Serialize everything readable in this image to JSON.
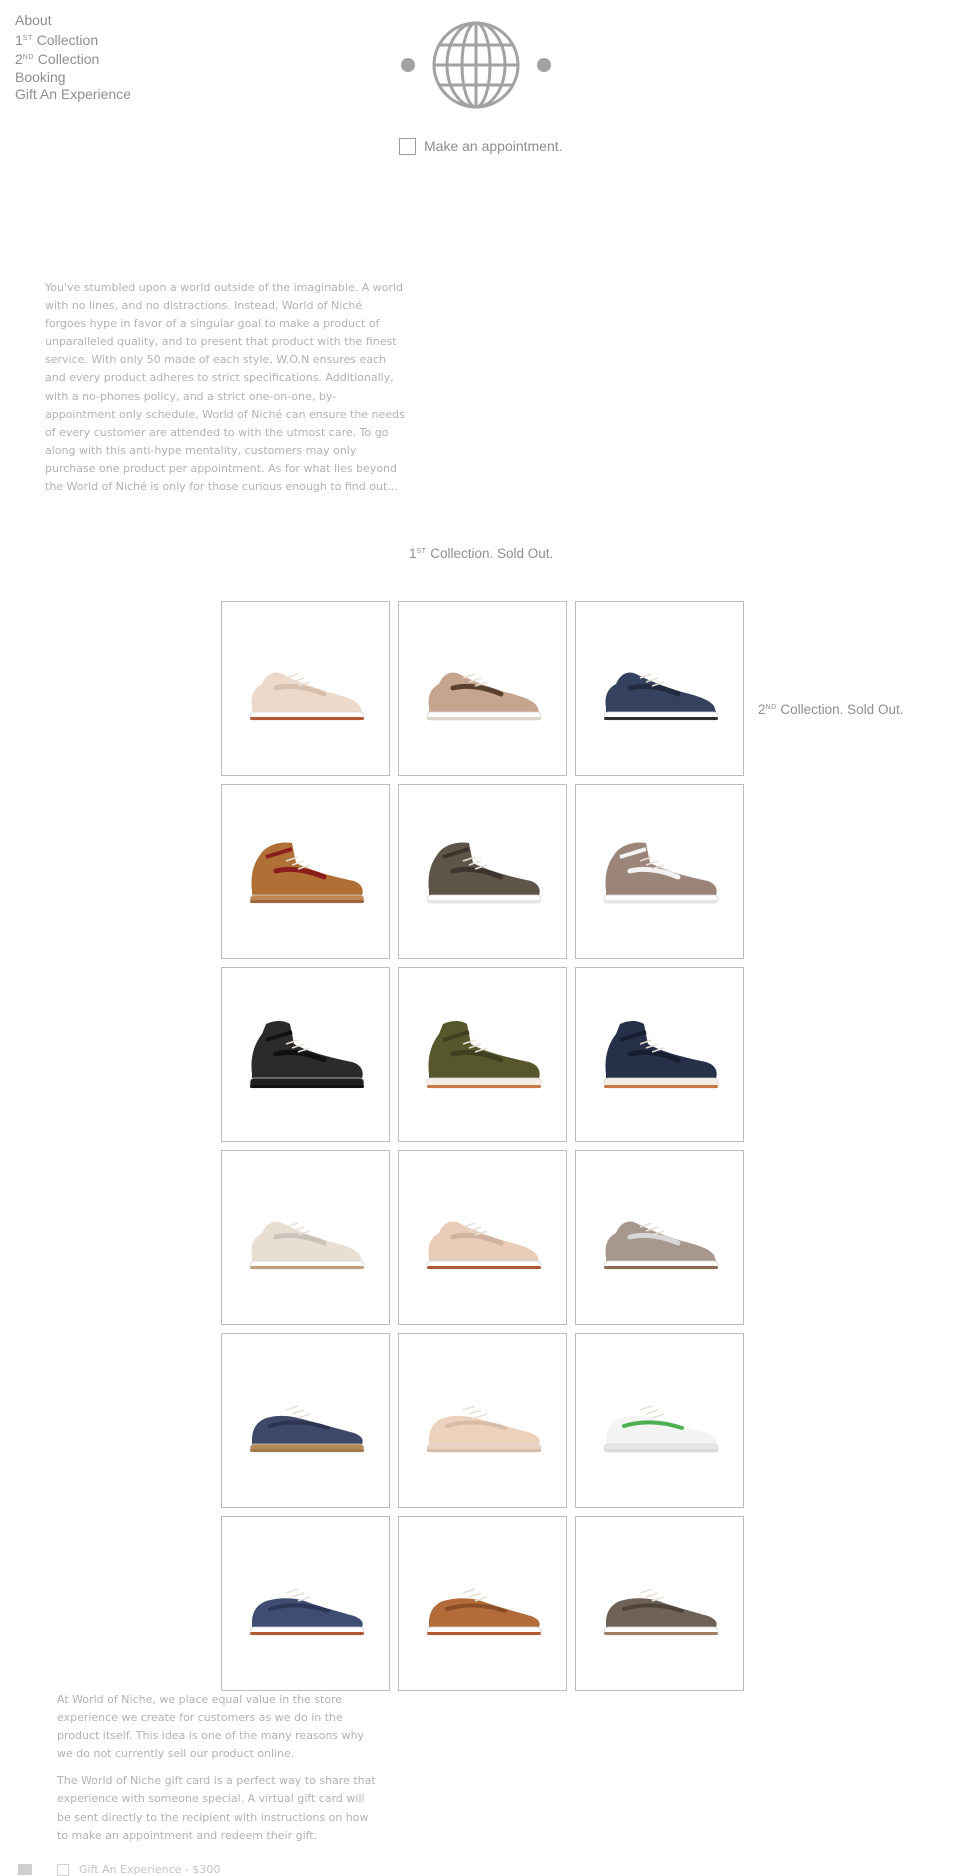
{
  "nav": {
    "about": "About",
    "c1_num": "1",
    "c1_sup": "ST",
    "c1_label": " Collection",
    "c2_num": "2",
    "c2_sup": "ND",
    "c2_label": " Collection",
    "booking": "Booking",
    "gift": "Gift An Experience"
  },
  "logo": {
    "icon": "globe-icon"
  },
  "appointment": {
    "label": "Make an appointment."
  },
  "intro": "You've stumbled upon a world outside of the imaginable. A world with no lines, and no distractions. Instead, World of Niché forgoes hype in favor of a singular goal to make a product of unparalleled quality, and to present that product with the finest service. With only 50 made of each style, W.O.N ensures each and every product adheres to strict specifications. Additionally, with a no-phones policy, and a strict one-on-one, by-appointment only schedule, World of Niché can ensure the needs of every customer are attended to with the utmost care. To go along with this anti-hype mentality, customers may only purchase one product per appointment. As for what lies beyond the World of Niché is only for those curious enough to find out...",
  "collection1": {
    "num": "1",
    "sup": "ST",
    "label": " Collection. Sold Out."
  },
  "collection2": {
    "num": "2",
    "sup": "ND",
    "label": " Collection. Sold Out."
  },
  "products": [
    {
      "style": "runner",
      "upper": "#ecd9c9",
      "accent": "#d7c0ad",
      "sole": "#ffffff",
      "heel": "#b05a36"
    },
    {
      "style": "runner",
      "upper": "#c6a58f",
      "accent": "#5a3f2e",
      "sole": "#ffffff",
      "heel": "#d9d3ca"
    },
    {
      "style": "runner",
      "upper": "#34425f",
      "accent": "#232b40",
      "sole": "#ffffff",
      "heel": "#2d2d2d"
    },
    {
      "style": "hightop",
      "upper": "#b06f34",
      "accent": "#8b1d1d",
      "sole": "#c08652",
      "heel": "#9c6638"
    },
    {
      "style": "hightop",
      "upper": "#5f5448",
      "accent": "#3d352d",
      "sole": "#ffffff",
      "heel": "#e7e7e7"
    },
    {
      "style": "hightop",
      "upper": "#9b8579",
      "accent": "#f2f2f2",
      "sole": "#ffffff",
      "heel": "#e7e7e7"
    },
    {
      "style": "boot",
      "upper": "#2b2b2b",
      "accent": "#111111",
      "sole": "#1f1f1f",
      "heel": "#111111"
    },
    {
      "style": "boot",
      "upper": "#56572c",
      "accent": "#3f401f",
      "sole": "#f4efe6",
      "heel": "#c77a45"
    },
    {
      "style": "boot",
      "upper": "#263149",
      "accent": "#161e30",
      "sole": "#f4efe6",
      "heel": "#c77a45"
    },
    {
      "style": "runner",
      "upper": "#e8dfd2",
      "accent": "#c9c3ba",
      "sole": "#ffffff",
      "heel": "#c2a07e"
    },
    {
      "style": "runner",
      "upper": "#e9cdb8",
      "accent": "#cfb39e",
      "sole": "#ffffff",
      "heel": "#b05a36"
    },
    {
      "style": "runner",
      "upper": "#a8978c",
      "accent": "#d7d7d7",
      "sole": "#ffffff",
      "heel": "#8c6a55"
    },
    {
      "style": "lowtop",
      "upper": "#3e4868",
      "accent": "#2d3550",
      "sole": "#b78a5a",
      "heel": "#a47a4f"
    },
    {
      "style": "lowtop",
      "upper": "#ecd1bd",
      "accent": "#d9bca6",
      "sole": "#ead3c2",
      "heel": "#d9bca6"
    },
    {
      "style": "lowtop",
      "upper": "#f4f4f4",
      "accent": "#4caf50",
      "sole": "#e7e7e7",
      "heel": "#d9d9d9"
    },
    {
      "style": "moc",
      "upper": "#3f4d73",
      "accent": "#2c3757",
      "sole": "#ffffff",
      "heel": "#b05a36"
    },
    {
      "style": "moc",
      "upper": "#b36b3a",
      "accent": "#8a4f28",
      "sole": "#ffffff",
      "heel": "#b05a36"
    },
    {
      "style": "moc",
      "upper": "#6e6258",
      "accent": "#4e443c",
      "sole": "#ffffff",
      "heel": "#a08062"
    }
  ],
  "outro": {
    "p1": "At World of Niche, we place equal value in the store experience we create for customers as we do in the product itself. This idea is one of the many reasons why we do not currently sell our product online.",
    "p2": "The World of Niche gift card is a perfect way to share that experience with someone special. A virtual gift card will be sent directly to the recipient with instructions on how to make an appointment and redeem their gift."
  },
  "gift_option": {
    "label": "Gift An Experience - $300"
  }
}
